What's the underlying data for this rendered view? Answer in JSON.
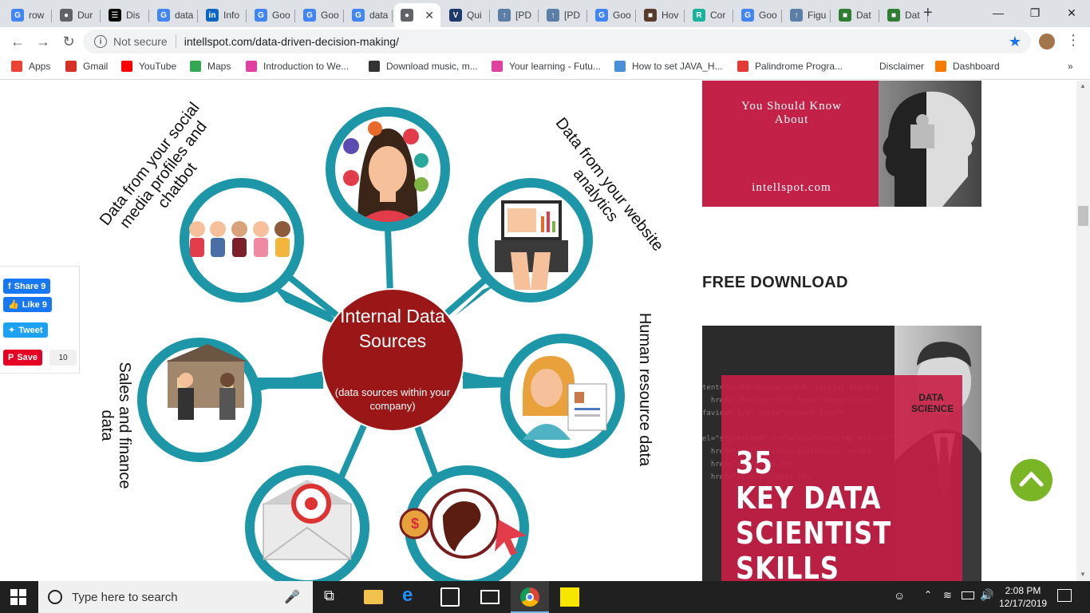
{
  "browser": {
    "tabs": [
      {
        "label": "row",
        "fav": "G",
        "color": "#4285f4"
      },
      {
        "label": "Dur",
        "fav": "●",
        "color": "#5f6368"
      },
      {
        "label": "Dis",
        "fav": "☰",
        "color": "#000000"
      },
      {
        "label": "data",
        "fav": "G",
        "color": "#4285f4"
      },
      {
        "label": "Info",
        "fav": "in",
        "color": "#0a66c2"
      },
      {
        "label": "Goo",
        "fav": "G",
        "color": "#4285f4"
      },
      {
        "label": "Goo",
        "fav": "G",
        "color": "#4285f4"
      },
      {
        "label": "data",
        "fav": "G",
        "color": "#4285f4"
      },
      {
        "label": "",
        "fav": "●",
        "color": "#5f6368",
        "active": true
      },
      {
        "label": "Qui",
        "fav": "V",
        "color": "#1b3a6b"
      },
      {
        "label": "[PD",
        "fav": "↑",
        "color": "#5b7fa6"
      },
      {
        "label": "[PD",
        "fav": "↑",
        "color": "#5b7fa6"
      },
      {
        "label": "Goo",
        "fav": "G",
        "color": "#4285f4"
      },
      {
        "label": "Hov",
        "fav": "■",
        "color": "#5a3a2a"
      },
      {
        "label": "Cor",
        "fav": "R",
        "color": "#17b39a"
      },
      {
        "label": "Goo",
        "fav": "G",
        "color": "#4285f4"
      },
      {
        "label": "Figu",
        "fav": "↑",
        "color": "#5b7fa6"
      },
      {
        "label": "Dat",
        "fav": "■",
        "color": "#2e7d32"
      },
      {
        "label": "Dat",
        "fav": "■",
        "color": "#2e7d32"
      }
    ],
    "new_tab": "+",
    "not_secure": "Not secure",
    "url": "intellspot.com/data-driven-decision-making/",
    "bookmarks": [
      {
        "label": "Apps",
        "color": "#ea4335"
      },
      {
        "label": "Gmail",
        "color": "#d93025"
      },
      {
        "label": "YouTube",
        "color": "#ff0000"
      },
      {
        "label": "Maps",
        "color": "#34a853"
      },
      {
        "label": "Introduction to We...",
        "color": "#e040a0"
      },
      {
        "label": "Download music, m...",
        "color": "#333333"
      },
      {
        "label": "Your learning - Futu...",
        "color": "#e040a0"
      },
      {
        "label": "How to set JAVA_H...",
        "color": "#4a90d9"
      },
      {
        "label": "Palindrome Progra...",
        "color": "#e53935"
      },
      {
        "label": "Disclaimer",
        "color": ""
      },
      {
        "label": "Dashboard",
        "color": "#f57c00"
      }
    ],
    "more": "»"
  },
  "infographic": {
    "center_title": "Internal Data Sources",
    "center_sub": "(data sources within your company)",
    "labels": {
      "social": "Data from your social media profiles and chatbot",
      "web": "Data from your website analytics",
      "hr": "Human resource data",
      "sales": "Sales and finance data"
    },
    "colors": {
      "teal": "#1d97a8",
      "center": "#9b1616"
    }
  },
  "share": {
    "share_label": "Share 9",
    "like_label": "Like 9",
    "tweet_label": "Tweet",
    "save_label": "Save",
    "save_count": "10"
  },
  "sidebar": {
    "ad1_line1": "You Should Know",
    "ad1_line2": "About",
    "ad1_site": "intellspot.com",
    "free_download": "FREE DOWNLOAD",
    "ad2_tag1": "DATA",
    "ad2_tag2": "SCIENCE",
    "ad2_num": "35",
    "ad2_line1": "KEY DATA",
    "ad2_line2": "SCIENTIST",
    "ad2_line3": "SKILLS"
  },
  "taskbar": {
    "search_placeholder": "Type here to search",
    "time": "2:08 PM",
    "date": "12/17/2019"
  }
}
